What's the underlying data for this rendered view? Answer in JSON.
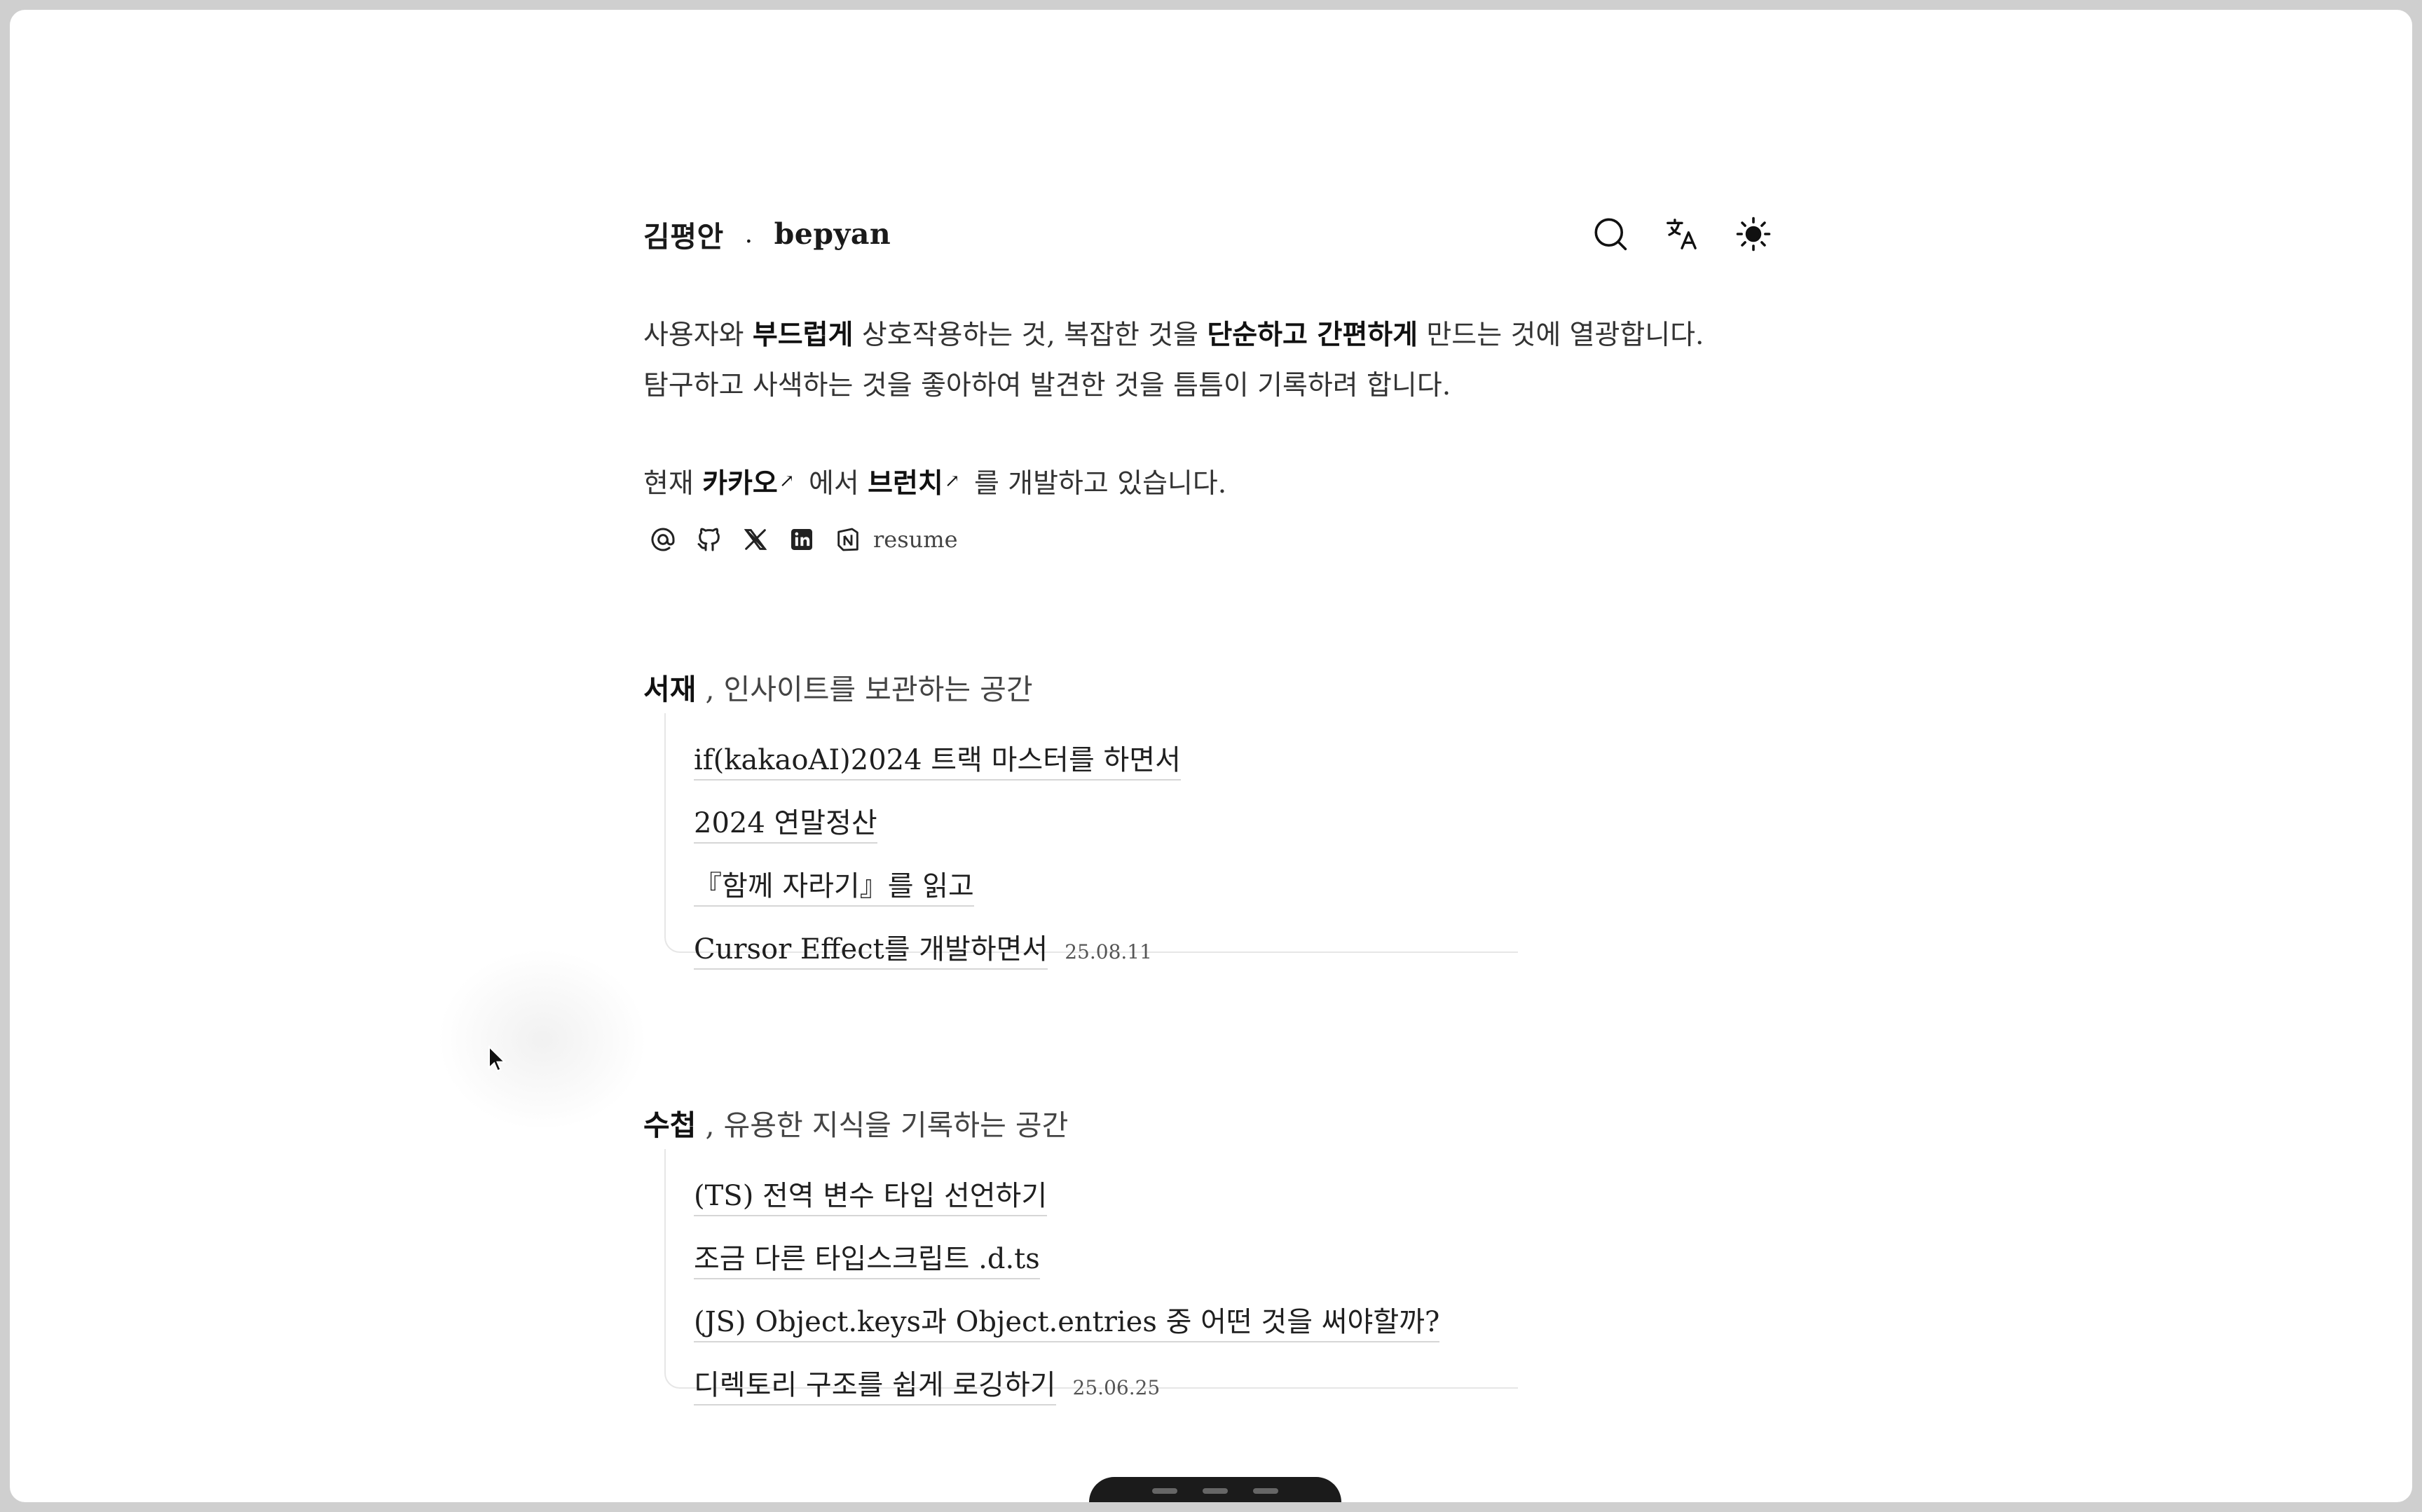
{
  "header": {
    "name_ko": "김평안",
    "separator": ".",
    "name_en": "bepyan",
    "tools": [
      "search-icon",
      "translate-icon",
      "sun-icon"
    ]
  },
  "intro": {
    "line1_a": "사용자와 ",
    "line1_b": "부드럽게",
    "line1_c": " 상호작용하는 것, 복잡한 것을 ",
    "line1_d": "단순하고 간편하게",
    "line1_e": " 만드는 것에 열광합니다.",
    "line2": "탐구하고 사색하는 것을 좋아하여 발견한 것을 틈틈이 기록하려 합니다."
  },
  "current": {
    "prefix": "현재 ",
    "company": "카카오",
    "mid": " 에서 ",
    "product": "브런치",
    "suffix": " 를 개발하고 있습니다.",
    "arrow": "↗"
  },
  "socials": {
    "icons": [
      "at-icon",
      "github-icon",
      "x-icon",
      "linkedin-icon",
      "notion-icon"
    ],
    "resume_label": "resume"
  },
  "sections": [
    {
      "title": "서재",
      "subtitle": " , 인사이트를 보관하는 공간",
      "items": [
        {
          "title": "if(kakaoAI)2024 트랙 마스터를 하면서",
          "date": ""
        },
        {
          "title": "2024 연말정산",
          "date": ""
        },
        {
          "title": "『함께 자라기』를 읽고",
          "date": ""
        },
        {
          "title": "Cursor Effect를 개발하면서",
          "date": "25.08.11"
        }
      ]
    },
    {
      "title": "수첩",
      "subtitle": " , 유용한 지식을 기록하는 공간",
      "items": [
        {
          "title": "(TS) 전역 변수 타입 선언하기",
          "date": ""
        },
        {
          "title": "조금 다른 타입스크립트 .d.ts",
          "date": ""
        },
        {
          "title": "(JS) Object.keys과 Object.entries 중 어떤 것을 써야할까?",
          "date": ""
        },
        {
          "title": "디렉토리 구조를 쉽게 로깅하기",
          "date": "25.06.25"
        }
      ]
    }
  ]
}
